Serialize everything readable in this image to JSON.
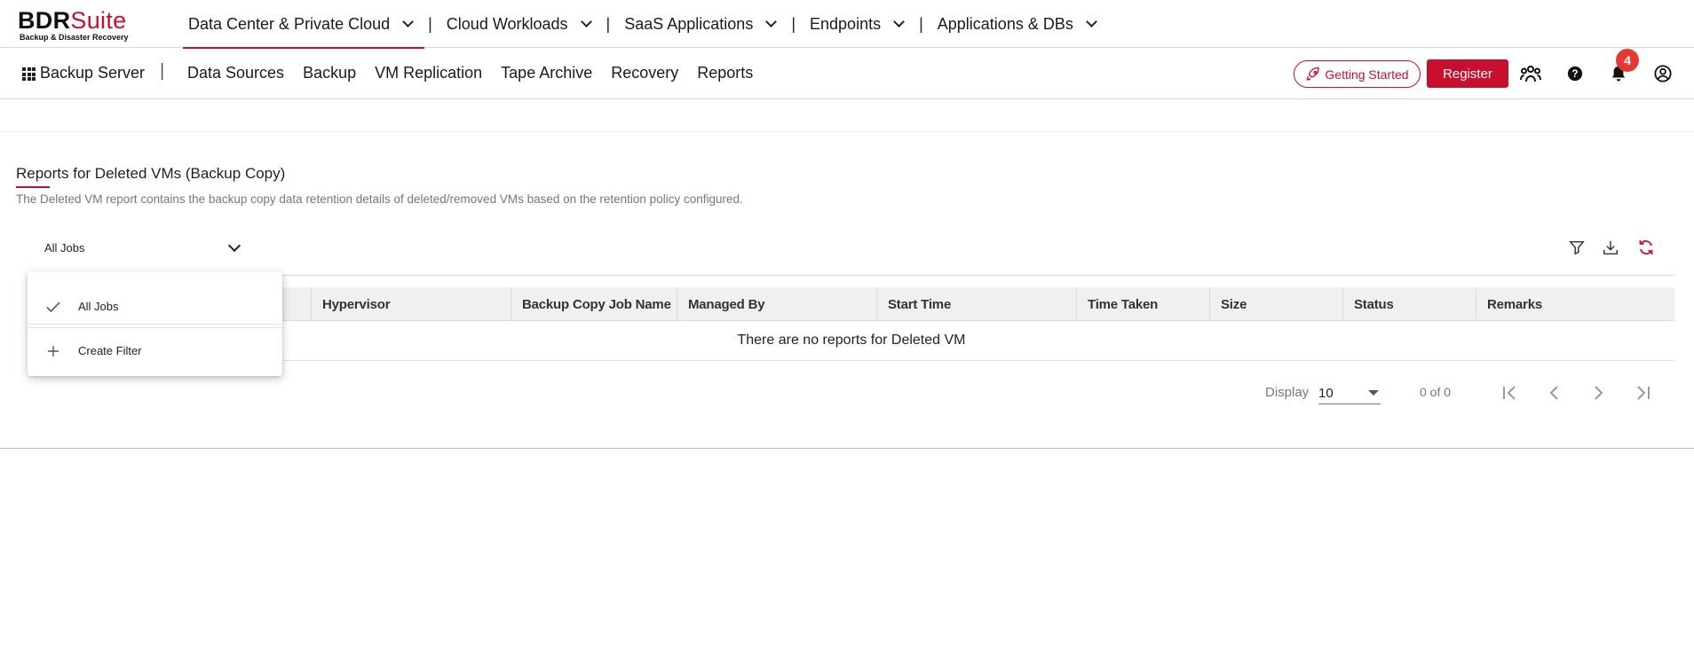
{
  "brand": {
    "name_black": "BDR",
    "name_red": "Suite",
    "tagline": "Backup & Disaster Recovery",
    "accent": "#c8102e"
  },
  "top_nav": [
    {
      "label": "Data Center & Private Cloud",
      "active": true
    },
    {
      "label": "Cloud Workloads",
      "active": false
    },
    {
      "label": "SaaS Applications",
      "active": false
    },
    {
      "label": "Endpoints",
      "active": false
    },
    {
      "label": "Applications & DBs",
      "active": false
    }
  ],
  "sub_nav": {
    "app_name": "Backup Server",
    "items": [
      "Data Sources",
      "Backup",
      "VM Replication",
      "Tape Archive",
      "Recovery",
      "Reports"
    ]
  },
  "header_actions": {
    "getting_started": "Getting Started",
    "register": "Register",
    "notification_count": "4",
    "icons": [
      "community-icon",
      "help-icon",
      "bell-icon",
      "user-icon"
    ]
  },
  "page": {
    "title": "Reports for Deleted VMs (Backup Copy)",
    "description": "The Deleted VM report contains the backup copy data retention details of deleted/removed VMs based on the retention policy configured."
  },
  "job_filter": {
    "selected": "All Jobs",
    "options": [
      "All Jobs",
      "Create Filter"
    ]
  },
  "toolbar_icons": [
    "filter-icon",
    "download-icon",
    "refresh-icon"
  ],
  "table": {
    "columns": [
      "",
      "Hypervisor",
      "Backup Copy Job Name",
      "Managed By",
      "Start Time",
      "Time Taken",
      "Size",
      "Status",
      "Remarks"
    ],
    "empty_message": "There are no reports for Deleted VM"
  },
  "pagination": {
    "display_label": "Display",
    "page_size": "10",
    "count_text": "0 of 0"
  }
}
